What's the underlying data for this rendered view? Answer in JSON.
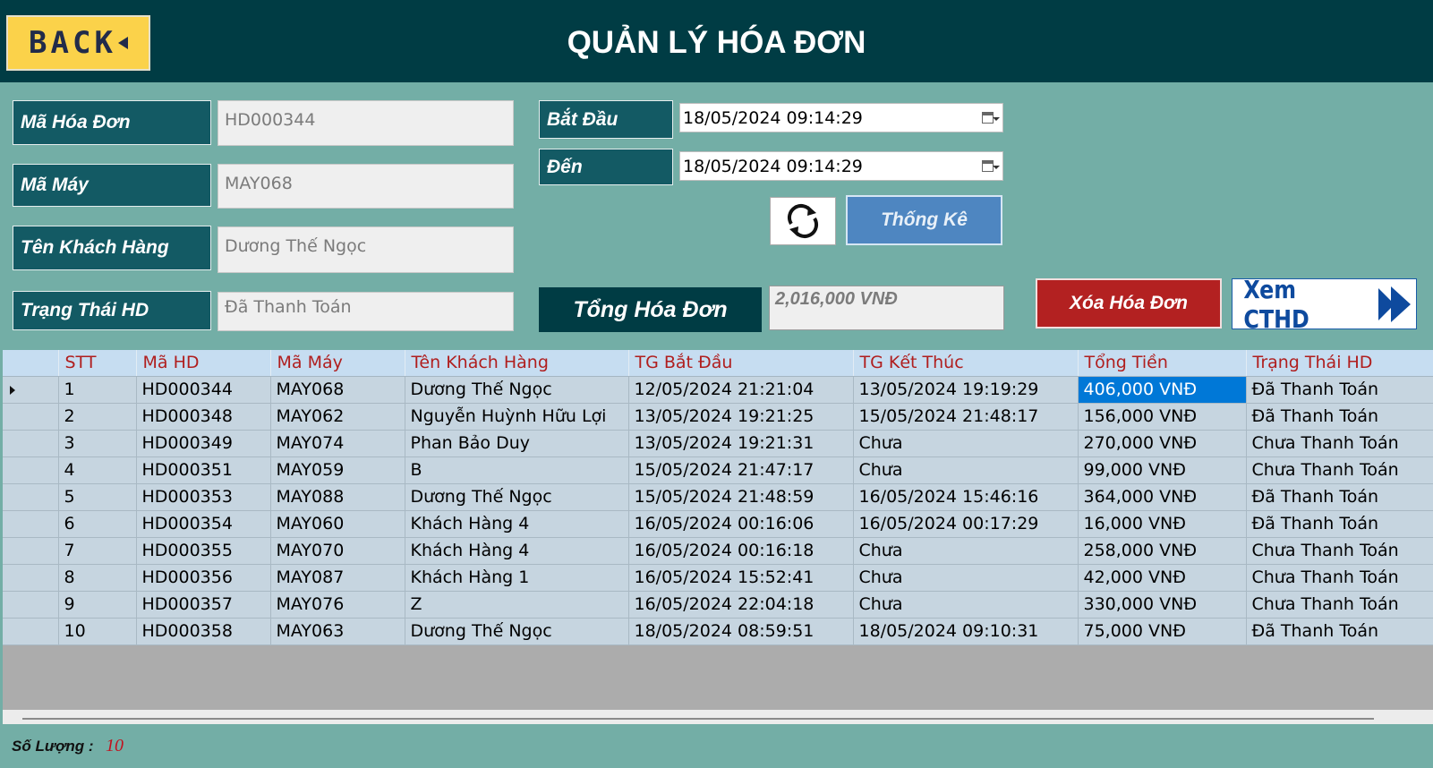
{
  "header": {
    "back_label": "BACK",
    "title": "QUẢN LÝ HÓA ĐƠN"
  },
  "form": {
    "ma_hoa_don": {
      "label": "Mã Hóa Đơn",
      "value": "HD000344"
    },
    "ma_may": {
      "label": "Mã Máy",
      "value": "MAY068"
    },
    "ten_khach_hang": {
      "label": "Tên Khách Hàng",
      "value": "Dương Thế Ngọc"
    },
    "trang_thai": {
      "label": "Trạng Thái HD",
      "value": "Đã Thanh Toán"
    }
  },
  "filters": {
    "bat_dau": {
      "label": "Bắt Đầu",
      "value": "18/05/2024 09:14:29"
    },
    "den": {
      "label": "Đến",
      "value": "18/05/2024 09:14:29"
    },
    "thong_ke_label": "Thống Kê"
  },
  "summary": {
    "tong_label": "Tổng Hóa Đơn",
    "tong_value": "2,016,000 VNĐ"
  },
  "actions": {
    "xoa_label": "Xóa Hóa Đơn",
    "xem_label": "Xem CTHD"
  },
  "table": {
    "columns": [
      "STT",
      "Mã HD",
      "Mã Máy",
      "Tên Khách Hàng",
      "TG Bắt Đầu",
      "TG Kết Thúc",
      "Tổng Tiền",
      "Trạng Thái HD"
    ],
    "rows": [
      [
        "1",
        "HD000344",
        "MAY068",
        "Dương Thế Ngọc",
        "12/05/2024 21:21:04",
        "13/05/2024 19:19:29",
        "406,000 VNĐ",
        "Đã Thanh Toán"
      ],
      [
        "2",
        "HD000348",
        "MAY062",
        "Nguyễn Huỳnh Hữu Lợi",
        "13/05/2024 19:21:25",
        "15/05/2024 21:48:17",
        "156,000 VNĐ",
        "Đã Thanh Toán"
      ],
      [
        "3",
        "HD000349",
        "MAY074",
        "Phan Bảo Duy",
        "13/05/2024 19:21:31",
        "Chưa",
        "270,000 VNĐ",
        "Chưa Thanh Toán"
      ],
      [
        "4",
        "HD000351",
        "MAY059",
        "B",
        "15/05/2024 21:47:17",
        "Chưa",
        "99,000 VNĐ",
        "Chưa Thanh Toán"
      ],
      [
        "5",
        "HD000353",
        "MAY088",
        "Dương Thế Ngọc",
        "15/05/2024 21:48:59",
        "16/05/2024 15:46:16",
        "364,000 VNĐ",
        "Đã Thanh Toán"
      ],
      [
        "6",
        "HD000354",
        "MAY060",
        "Khách Hàng 4",
        "16/05/2024 00:16:06",
        "16/05/2024 00:17:29",
        "16,000 VNĐ",
        "Đã Thanh Toán"
      ],
      [
        "7",
        "HD000355",
        "MAY070",
        "Khách Hàng 4",
        "16/05/2024 00:16:18",
        "Chưa",
        "258,000 VNĐ",
        "Chưa Thanh Toán"
      ],
      [
        "8",
        "HD000356",
        "MAY087",
        "Khách Hàng 1",
        "16/05/2024 15:52:41",
        "Chưa",
        "42,000 VNĐ",
        "Chưa Thanh Toán"
      ],
      [
        "9",
        "HD000357",
        "MAY076",
        "Z",
        "16/05/2024 22:04:18",
        "Chưa",
        "330,000 VNĐ",
        "Chưa Thanh Toán"
      ],
      [
        "10",
        "HD000358",
        "MAY063",
        "Dương Thế Ngọc",
        "18/05/2024 08:59:51",
        "18/05/2024 09:10:31",
        "75,000 VNĐ",
        "Đã Thanh Toán"
      ]
    ],
    "selected_row": 0,
    "selected_col": 6
  },
  "footer": {
    "so_luong_label": "Số Lượng :",
    "so_luong_value": "10"
  },
  "colors": {
    "window_bg": "#73aea6",
    "header_bg": "#003c44",
    "label_bg": "#135a64",
    "back_bg": "#fbd24a",
    "delete_bg": "#b32121",
    "stats_bg": "#4e86c1",
    "header_text": "#b01e1e",
    "selection": "#0078d7"
  },
  "icons": {
    "back": "arrow-left-icon",
    "refresh": "refresh-icon",
    "calendar": "calendar-icon",
    "forward": "double-chevron-right-icon"
  }
}
